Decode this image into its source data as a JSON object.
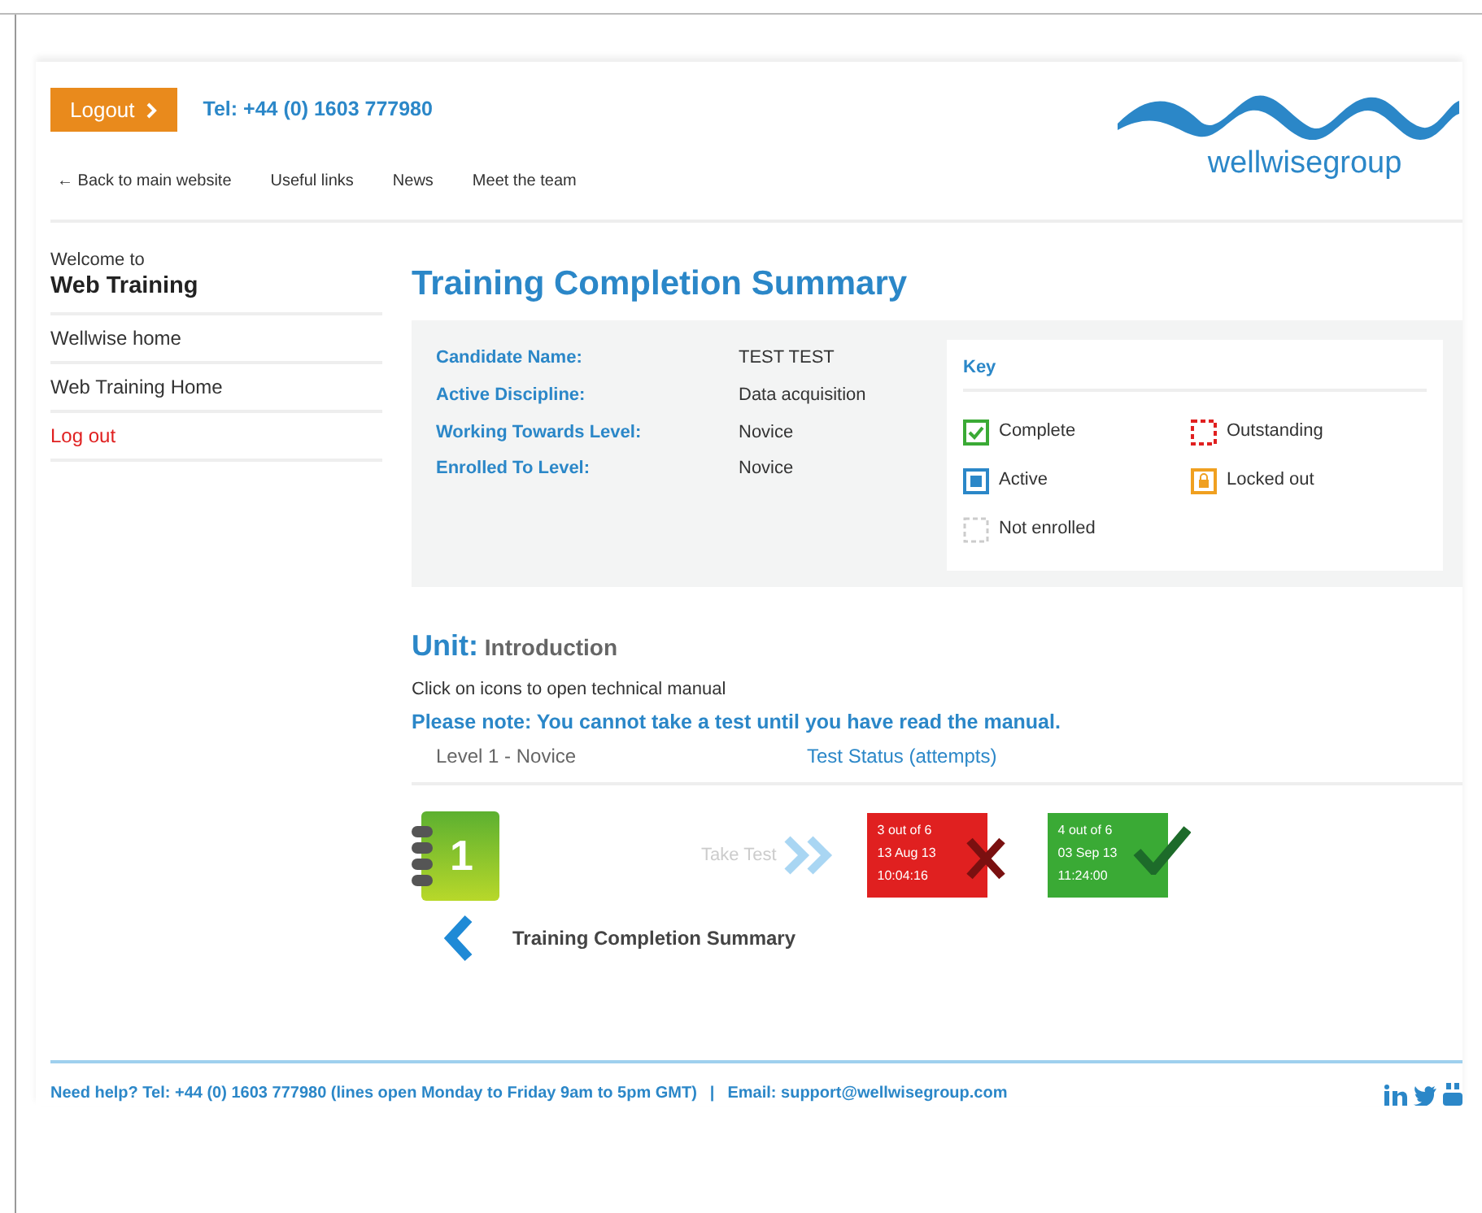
{
  "header": {
    "logout_button": "Logout",
    "phone": "Tel: +44 (0) 1603 777980",
    "nav_links": [
      {
        "label": "← Back to main website"
      },
      {
        "label": "Useful links"
      },
      {
        "label": "News"
      },
      {
        "label": "Meet the team"
      }
    ],
    "logo_text": "wellwisegroup"
  },
  "sidebar": {
    "welcome": "Welcome to",
    "title": "Web Training",
    "items": [
      {
        "label": "Wellwise home",
        "kind": "normal"
      },
      {
        "label": "Web Training Home",
        "kind": "normal"
      },
      {
        "label": "Log out",
        "kind": "logout"
      }
    ]
  },
  "page_title": "Training Completion Summary",
  "summary": [
    {
      "label": "Candidate Name:",
      "value": "TEST TEST"
    },
    {
      "label": "Active Discipline:",
      "value": "Data acquisition"
    },
    {
      "label": "Working Towards Level:",
      "value": "Novice"
    },
    {
      "label": "Enrolled To Level:",
      "value": "Novice"
    }
  ],
  "key": {
    "title": "Key",
    "items": [
      {
        "kind": "complete",
        "label": "Complete"
      },
      {
        "kind": "outstanding",
        "label": "Outstanding"
      },
      {
        "kind": "active",
        "label": "Active"
      },
      {
        "kind": "locked",
        "label": "Locked out"
      },
      {
        "kind": "not_enrolled",
        "label": "Not enrolled"
      }
    ]
  },
  "unit": {
    "prefix": "Unit:",
    "name": "Introduction",
    "instruction": "Click on icons to open technical manual",
    "note": "Please note: You cannot take a test until you have read the manual.",
    "level_heading": "Level 1 - Novice",
    "status_heading": "Test Status (attempts)",
    "manual_number": "1",
    "take_test": "Take Test",
    "attempts": [
      {
        "passed": false,
        "lines": [
          "3 out of 6",
          "13 Aug 13",
          "10:04:16"
        ]
      },
      {
        "passed": true,
        "lines": [
          "4 out of 6",
          "03 Sep 13",
          "11:24:00"
        ]
      }
    ],
    "back_link": "Training Completion Summary"
  },
  "footer": {
    "help": "Need help? Tel: +44 (0) 1603 777980 (lines open Monday to Friday 9am to 5pm GMT)",
    "separator": "|",
    "email": "Email: support@wellwisegroup.com"
  }
}
